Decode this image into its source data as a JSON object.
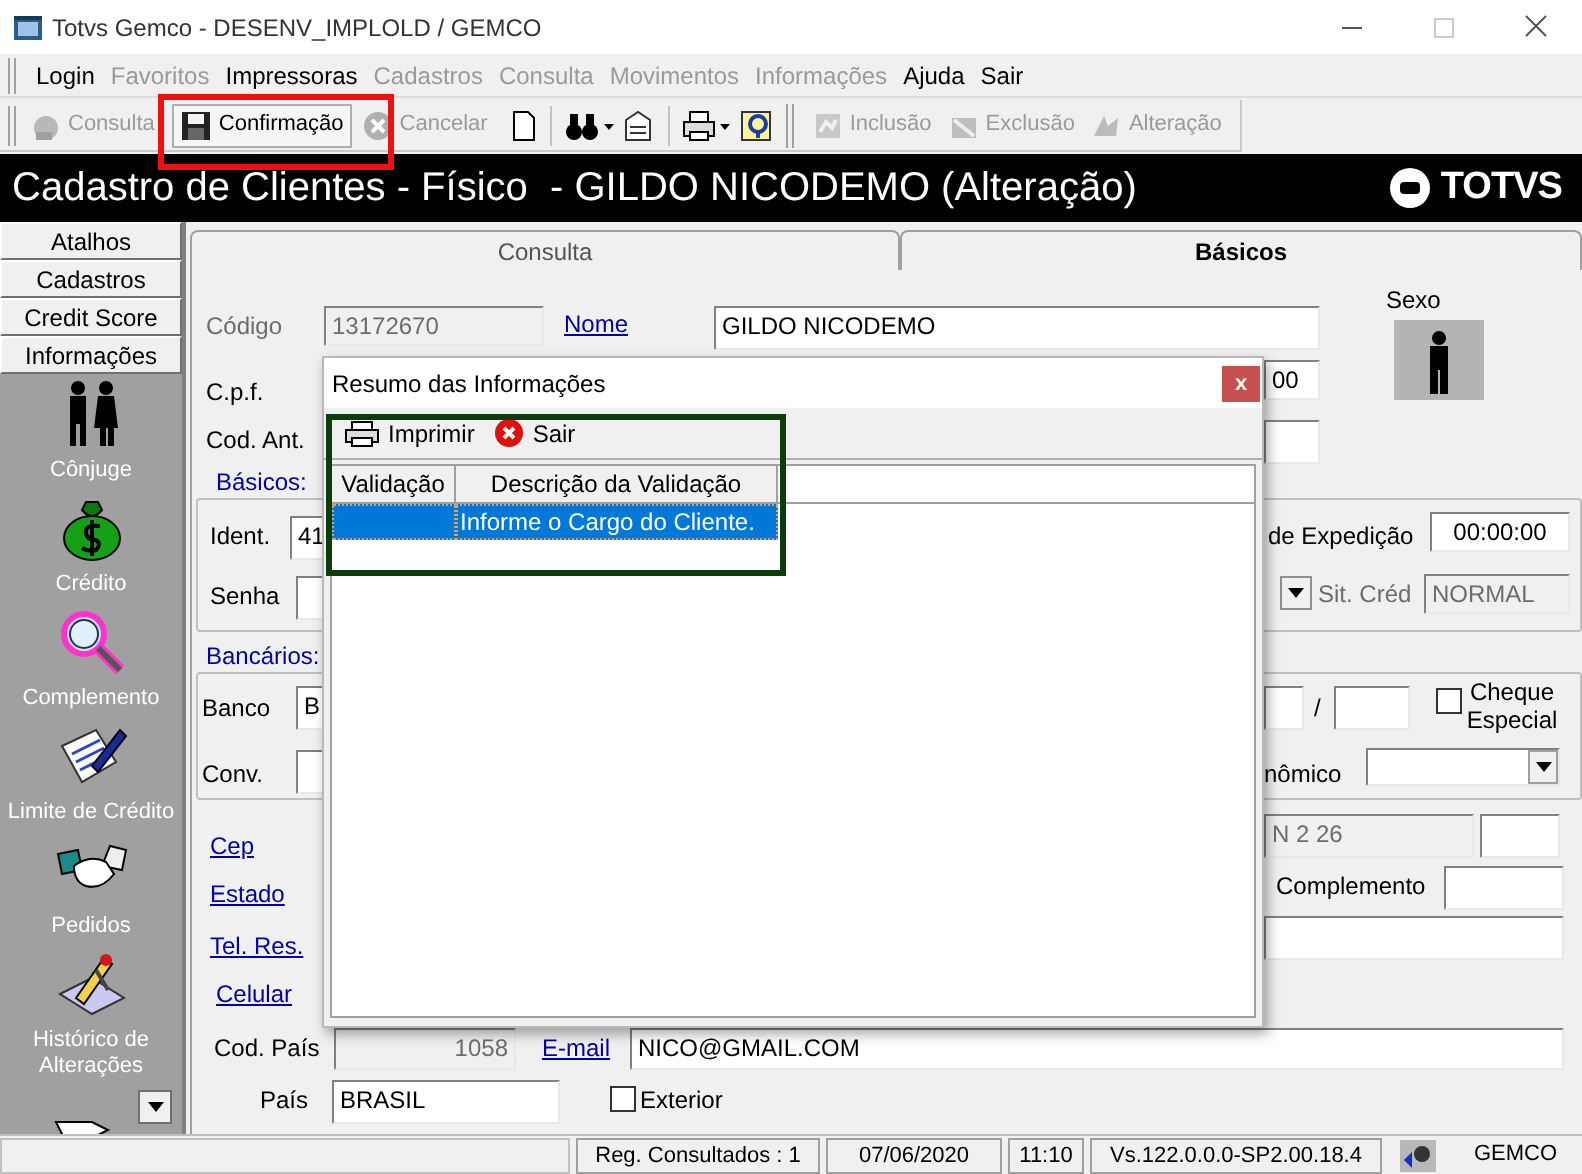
{
  "window": {
    "title": "Totvs Gemco - DESENV_IMPLOLD / GEMCO"
  },
  "menu": [
    {
      "label": "Login",
      "disabled": false
    },
    {
      "label": "Favoritos",
      "disabled": true
    },
    {
      "label": "Impressoras",
      "disabled": false
    },
    {
      "label": "Cadastros",
      "disabled": true
    },
    {
      "label": "Consulta",
      "disabled": true
    },
    {
      "label": "Movimentos",
      "disabled": true
    },
    {
      "label": "Informações",
      "disabled": true
    },
    {
      "label": "Ajuda",
      "disabled": false
    },
    {
      "label": "Sair",
      "disabled": false
    }
  ],
  "toolbar": [
    {
      "label": "Consulta",
      "disabled": true
    },
    {
      "label": "Confirmação",
      "disabled": false
    },
    {
      "label": "Cancelar",
      "disabled": true
    },
    {
      "label": "Inclusão",
      "disabled": true
    },
    {
      "label": "Exclusão",
      "disabled": true
    },
    {
      "label": "Alteração",
      "disabled": true
    }
  ],
  "header": {
    "title": "Cadastro de Clientes - Físico  - GILDO NICODEMO (Alteração)",
    "logo": "TOTVS"
  },
  "sidebar": {
    "sections": [
      "Atalhos",
      "Cadastros",
      "Credit Score",
      "Informações"
    ],
    "items": [
      "Cônjuge",
      "Crédito",
      "Complemento",
      "Limite de Crédito",
      "Pedidos",
      "Histórico de Alterações"
    ]
  },
  "tabs": [
    {
      "label": "Consulta",
      "selected": false
    },
    {
      "label": "Básicos",
      "selected": true
    }
  ],
  "form": [
    {
      "kind": "label",
      "text": "Código",
      "disabled": true
    },
    {
      "kind": "input",
      "value": "13172670",
      "disabled": true
    },
    {
      "kind": "link",
      "text": "Nome",
      "disabled": false
    },
    {
      "kind": "input",
      "value": "GILDO NICODEMO",
      "disabled": false
    },
    {
      "kind": "label",
      "text": "Sexo",
      "disabled": false
    },
    {
      "kind": "figure",
      "disabled": false
    },
    {
      "kind": "label",
      "text": "C.p.f.",
      "disabled": false
    },
    {
      "kind": "input",
      "value": "00",
      "disabled": false
    },
    {
      "kind": "label",
      "text": "Cod. Ant.",
      "disabled": false
    },
    {
      "kind": "input",
      "disabled": false
    },
    {
      "kind": "group",
      "text": "Básicos:",
      "disabled": false
    },
    {
      "kind": "label",
      "text": "Ident.",
      "disabled": false
    },
    {
      "kind": "input",
      "value": "41",
      "disabled": false
    },
    {
      "kind": "label",
      "text": "de Expedição",
      "disabled": false
    },
    {
      "kind": "input",
      "value": "00:00:00",
      "disabled": false
    },
    {
      "kind": "label",
      "text": "Senha",
      "disabled": false
    },
    {
      "kind": "input",
      "disabled": false
    },
    {
      "kind": "dropdown",
      "disabled": false
    },
    {
      "kind": "label",
      "text": "Sit. Créd",
      "disabled": true
    },
    {
      "kind": "input",
      "value": "NORMAL",
      "disabled": true
    },
    {
      "kind": "group",
      "text": "Bancários:",
      "disabled": false
    },
    {
      "kind": "label",
      "text": "Banco",
      "disabled": false
    },
    {
      "kind": "input",
      "value": "B",
      "disabled": false
    },
    {
      "kind": "input",
      "disabled": false
    },
    {
      "kind": "label",
      "text": "/",
      "disabled": false
    },
    {
      "kind": "input",
      "disabled": false
    },
    {
      "kind": "checkbox",
      "checked": false,
      "disabled": false
    },
    {
      "kind": "label",
      "text": "Cheque Especial",
      "disabled": false
    },
    {
      "kind": "label",
      "text": "Conv.",
      "disabled": false
    },
    {
      "kind": "input",
      "disabled": false
    },
    {
      "kind": "label",
      "text": "nômico",
      "disabled": false
    },
    {
      "kind": "select",
      "disabled": false
    },
    {
      "kind": "link",
      "text": "Cep",
      "disabled": false
    },
    {
      "kind": "input",
      "value": "N 2 26",
      "disabled": true
    },
    {
      "kind": "input",
      "disabled": false
    },
    {
      "kind": "link",
      "text": "Estado",
      "disabled": false
    },
    {
      "kind": "label",
      "text": "Complemento",
      "disabled": false
    },
    {
      "kind": "input",
      "disabled": false
    },
    {
      "kind": "link",
      "text": "Tel. Res.",
      "disabled": false
    },
    {
      "kind": "input",
      "disabled": false
    },
    {
      "kind": "link",
      "text": "Celular",
      "disabled": false
    },
    {
      "kind": "label",
      "text": "Cod. País",
      "disabled": false
    },
    {
      "kind": "input",
      "value": "1058",
      "disabled": true
    },
    {
      "kind": "link",
      "text": "E-mail",
      "disabled": false
    },
    {
      "kind": "input",
      "value": "NICO@GMAIL.COM",
      "disabled": false
    },
    {
      "kind": "label",
      "text": "País",
      "disabled": false
    },
    {
      "kind": "input",
      "value": "BRASIL",
      "disabled": false
    },
    {
      "kind": "checkbox",
      "checked": false,
      "disabled": false
    },
    {
      "kind": "label",
      "text": "Exterior",
      "disabled": false
    }
  ],
  "dialog": {
    "title": "Resumo das Informações",
    "close": "x",
    "actions": [
      "Imprimir",
      "Sair"
    ],
    "columns": [
      "Validação",
      "Descrição da Validação"
    ],
    "rows": [
      {
        "description": "Informe o Cargo do Cliente.",
        "selected": true
      }
    ]
  },
  "status_bar": [
    "Reg. Consultados : 1",
    "07/06/2020",
    "11:10",
    "Vs.122.0.0.0-SP2.00.18.4",
    "GEMCO"
  ],
  "annotations": [
    {
      "color": "#ee1111"
    },
    {
      "color": "#0b3d0b"
    }
  ]
}
